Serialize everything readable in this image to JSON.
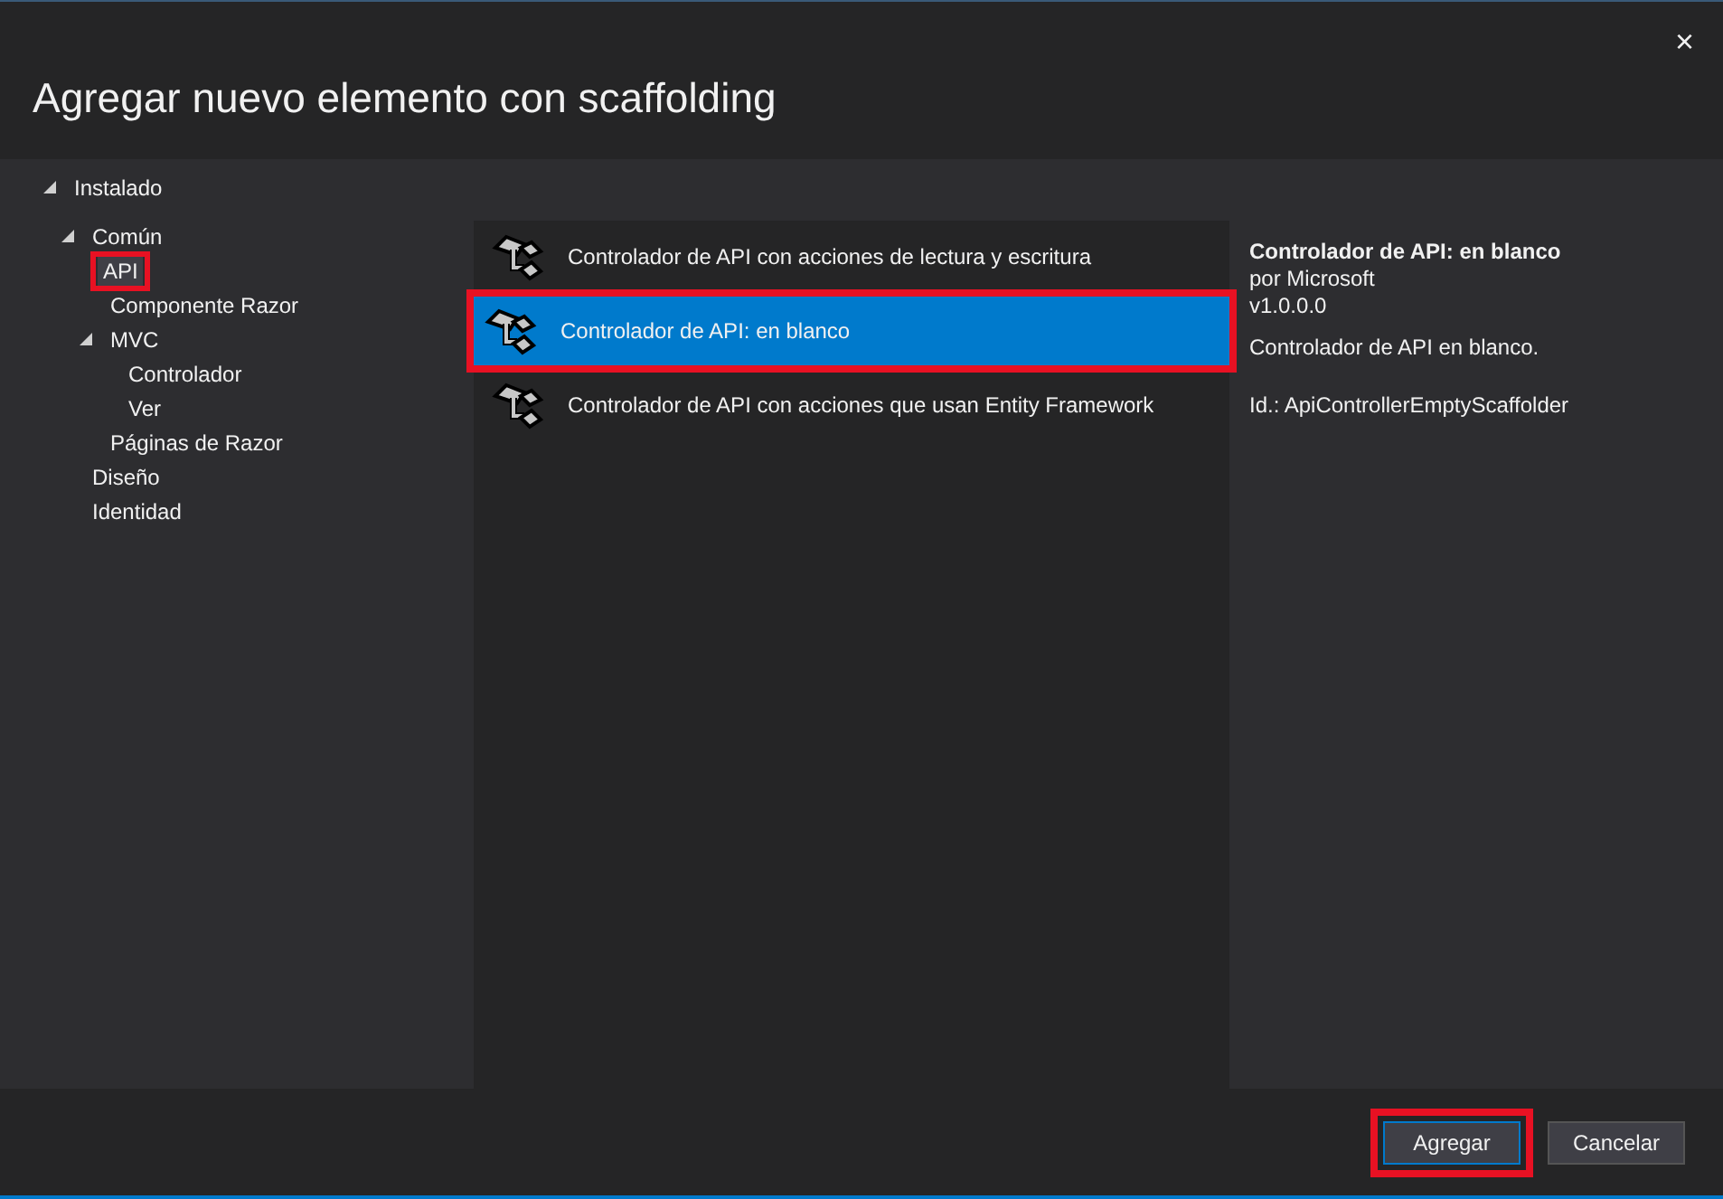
{
  "window": {
    "title": "Agregar nuevo elemento con scaffolding",
    "close": "×"
  },
  "tree": [
    {
      "label": "Instalado",
      "expanded": true,
      "selected": false,
      "annotated": false,
      "children": [
        {
          "label": "Común",
          "expanded": true,
          "selected": false,
          "annotated": false,
          "children": [
            {
              "label": "API",
              "selected": true,
              "annotated": true
            },
            {
              "label": "Componente Razor",
              "selected": false,
              "annotated": false
            },
            {
              "label": "MVC",
              "expanded": true,
              "selected": false,
              "annotated": false,
              "children": [
                {
                  "label": "Controlador",
                  "selected": false,
                  "annotated": false
                },
                {
                  "label": "Ver",
                  "selected": false,
                  "annotated": false
                }
              ]
            },
            {
              "label": "Páginas de Razor",
              "selected": false,
              "annotated": false
            }
          ]
        },
        {
          "label": "Diseño",
          "selected": false,
          "annotated": false
        },
        {
          "label": "Identidad",
          "selected": false,
          "annotated": false
        }
      ]
    }
  ],
  "templates": [
    {
      "label": "Controlador de API con acciones de lectura y escritura",
      "selected": false,
      "annotated": false
    },
    {
      "label": "Controlador de API: en blanco",
      "selected": true,
      "annotated": true
    },
    {
      "label": "Controlador de API con acciones que usan Entity Framework",
      "selected": false,
      "annotated": false
    }
  ],
  "details": {
    "title": "Controlador de API: en blanco",
    "author": "por Microsoft",
    "version": "v1.0.0.0",
    "description": "Controlador de API en blanco.",
    "id": "Id.: ApiControllerEmptyScaffolder"
  },
  "buttons": [
    {
      "label": "Agregar",
      "primary": true,
      "annotated": true
    },
    {
      "label": "Cancelar",
      "primary": false,
      "annotated": false
    }
  ]
}
